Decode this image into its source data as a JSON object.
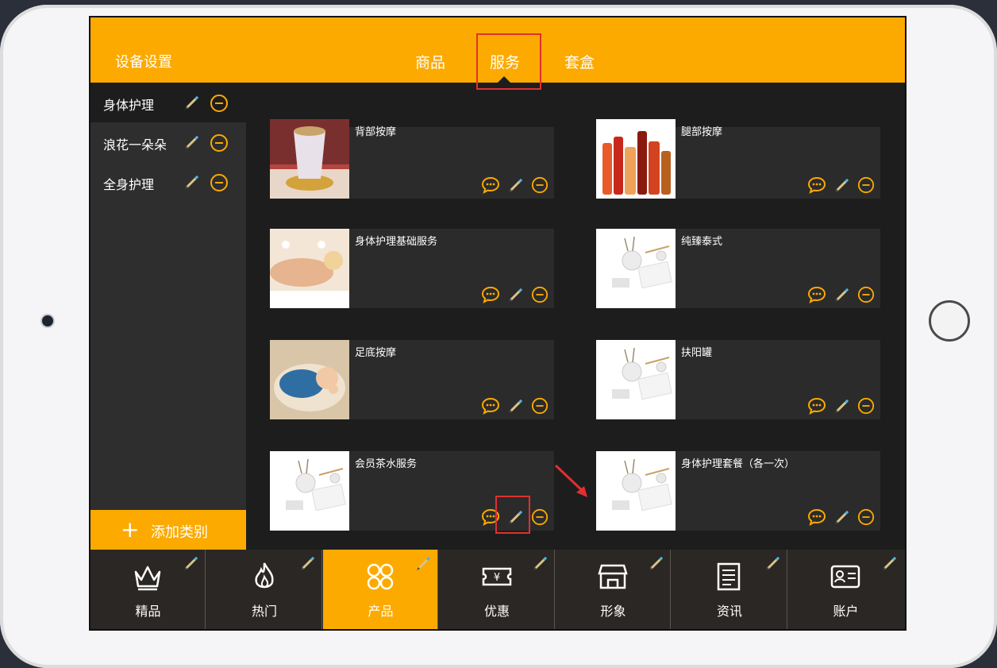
{
  "header": {
    "settings_label": "设备设置",
    "tabs": [
      {
        "label": "商品"
      },
      {
        "label": "服务"
      },
      {
        "label": "套盒"
      }
    ]
  },
  "sidebar": {
    "categories": [
      {
        "label": "身体护理"
      },
      {
        "label": "浪花一朵朵"
      },
      {
        "label": "全身护理"
      }
    ],
    "add_category_label": "添加类别"
  },
  "services": [
    {
      "name": "背部按摩",
      "image": "tea-cup-photo"
    },
    {
      "name": "腿部按摩",
      "image": "bottles-photo"
    },
    {
      "name": "身体护理基础服务",
      "image": "spa-massage-photo"
    },
    {
      "name": "纯臻泰式",
      "image": "spa-products-photo"
    },
    {
      "name": "足底按摩",
      "image": "sleeping-baby-photo"
    },
    {
      "name": "扶阳罐",
      "image": "spa-products-photo"
    },
    {
      "name": "会员茶水服务",
      "image": "spa-products-photo"
    },
    {
      "name": "身体护理套餐（各一次）",
      "image": "spa-products-photo"
    }
  ],
  "bottom_nav": [
    {
      "label": "精品",
      "icon": "crown-icon"
    },
    {
      "label": "热门",
      "icon": "flame-icon"
    },
    {
      "label": "产品",
      "icon": "grid-icon"
    },
    {
      "label": "优惠",
      "icon": "coupon-icon"
    },
    {
      "label": "形象",
      "icon": "store-icon"
    },
    {
      "label": "资讯",
      "icon": "news-icon"
    },
    {
      "label": "账户",
      "icon": "id-card-icon"
    }
  ],
  "colors": {
    "accent": "#fcaa00",
    "dark_bg": "#1d1d1d",
    "sidebar_bg": "#2e2e2e",
    "highlight_red": "#e03030"
  }
}
